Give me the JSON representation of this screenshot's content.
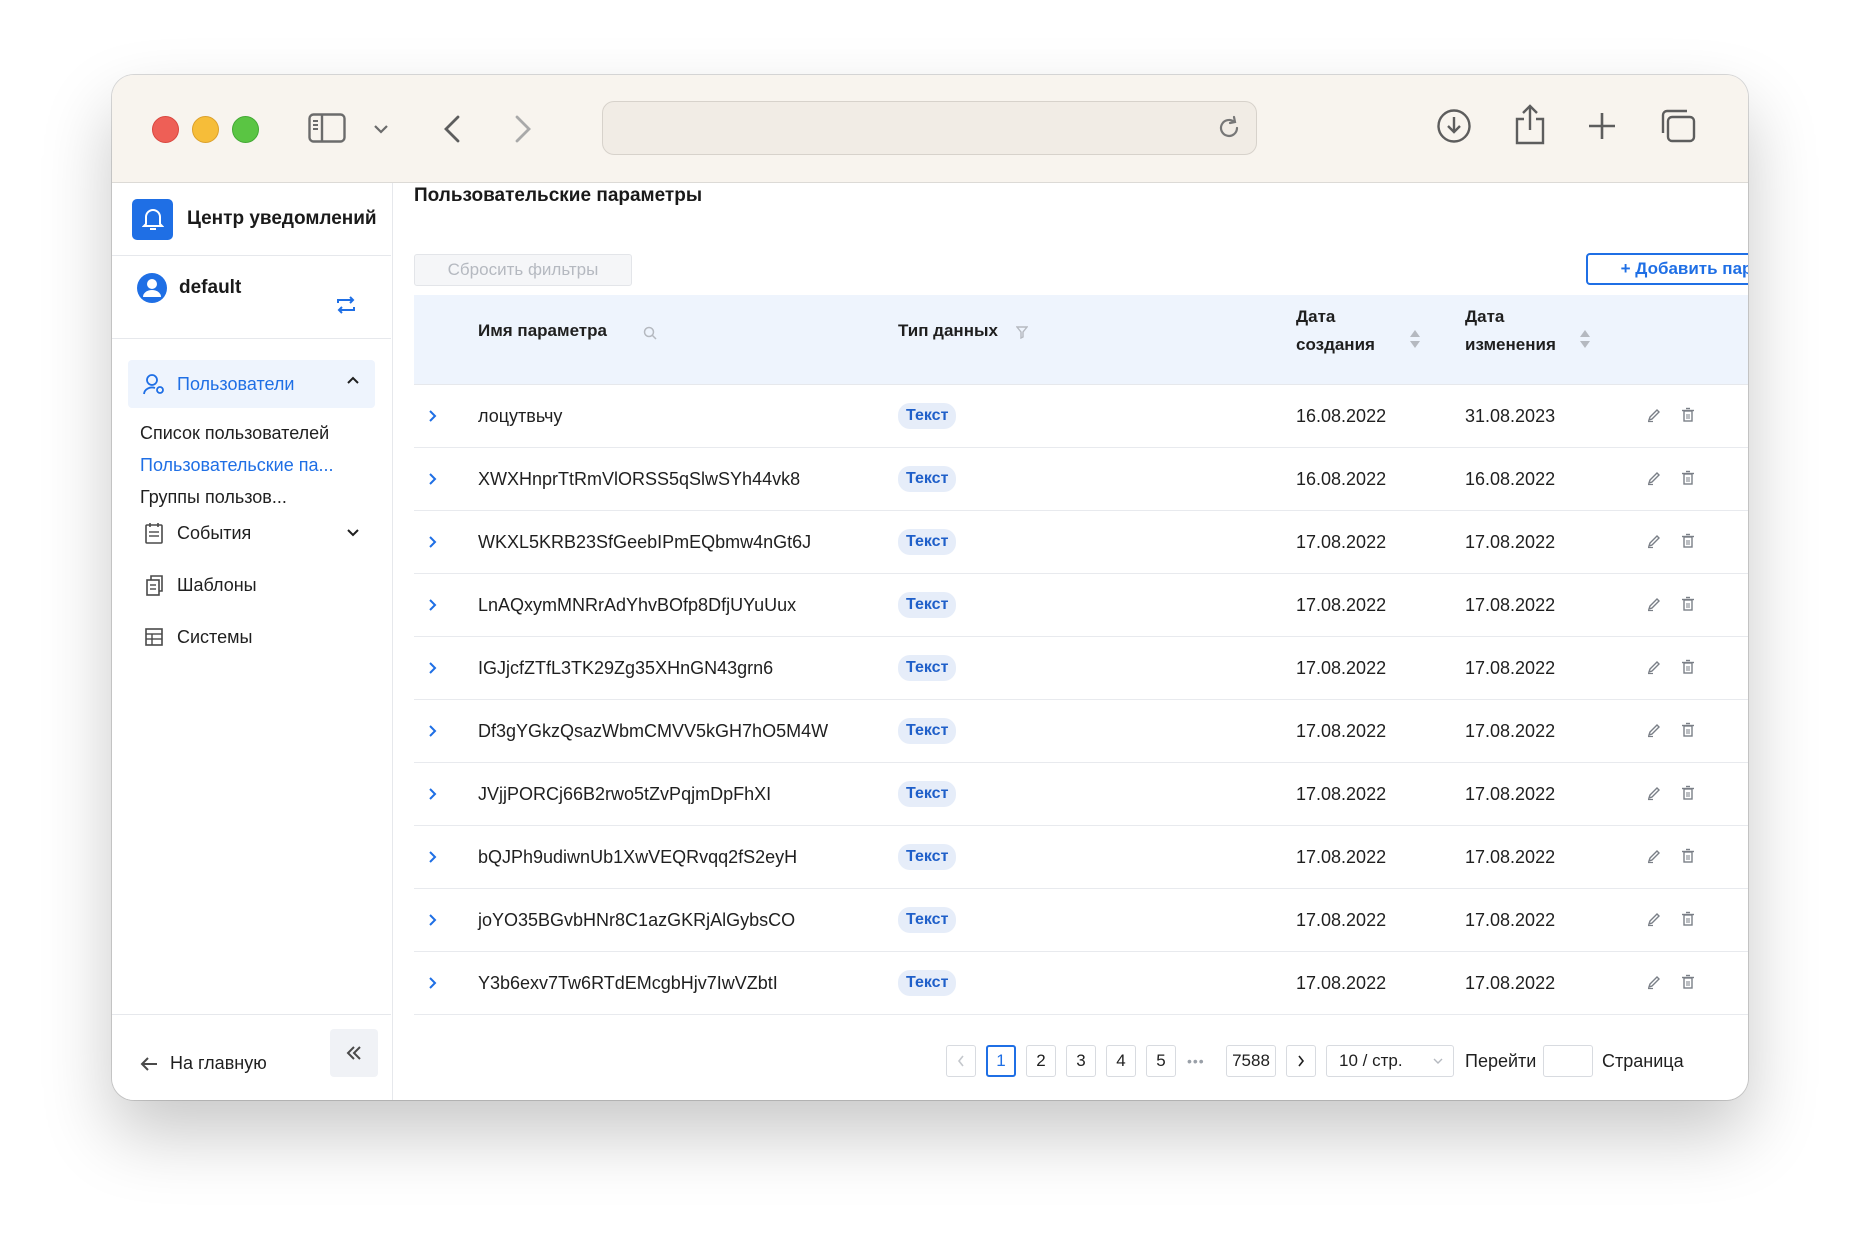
{
  "colors": {
    "accent": "#1f6fe5",
    "header_bg": "#eef4fd",
    "tag_bg": "#e6edf9",
    "titlebar_bg": "#f8f4ee"
  },
  "browser": {
    "url": "",
    "icons": [
      "sidebar-toggle-icon",
      "chevron-down-icon",
      "back-icon",
      "forward-icon",
      "reload-icon",
      "download-icon",
      "share-icon",
      "new-tab-icon",
      "tabs-overview-icon"
    ]
  },
  "sidebar": {
    "app_title": "Центр уведомлений",
    "user_name": "default",
    "group": {
      "label": "Пользователи",
      "icon": "user-settings-icon"
    },
    "subitems": [
      {
        "label": "Список пользователей",
        "active": false
      },
      {
        "label": "Пользовательские па...",
        "active": true
      },
      {
        "label": "Группы пользов...",
        "active": false
      }
    ],
    "items": [
      {
        "label": "События",
        "icon": "calendar-icon"
      },
      {
        "label": "Шаблоны",
        "icon": "copy-icon"
      },
      {
        "label": "Системы",
        "icon": "table-icon"
      }
    ],
    "home_label": "На главную"
  },
  "main": {
    "title": "Пользовательские параметры",
    "reset_button": "Сбросить фильтры",
    "add_button": "+ Добавить параметр",
    "columns": {
      "name": "Имя параметра",
      "type": "Тип данных",
      "created_l1": "Дата",
      "created_l2": "создания",
      "modified_l1": "Дата",
      "modified_l2": "изменения"
    },
    "rows": [
      {
        "name": "лоцутвьчу",
        "type": "Текст",
        "created": "16.08.2022",
        "modified": "31.08.2023"
      },
      {
        "name": "XWXHnprTtRmVlORSS5qSlwSYh44vk8",
        "type": "Текст",
        "created": "16.08.2022",
        "modified": "16.08.2022"
      },
      {
        "name": "WKXL5KRB23SfGeebIPmEQbmw4nGt6J",
        "type": "Текст",
        "created": "17.08.2022",
        "modified": "17.08.2022"
      },
      {
        "name": "LnAQxymMNRrAdYhvBOfp8DfjUYuUux",
        "type": "Текст",
        "created": "17.08.2022",
        "modified": "17.08.2022"
      },
      {
        "name": "IGJjcfZTfL3TK29Zg35XHnGN43grn6",
        "type": "Текст",
        "created": "17.08.2022",
        "modified": "17.08.2022"
      },
      {
        "name": "Df3gYGkzQsazWbmCMVV5kGH7hO5M4W",
        "type": "Текст",
        "created": "17.08.2022",
        "modified": "17.08.2022"
      },
      {
        "name": "JVjjPORCj66B2rwo5tZvPqjmDpFhXI",
        "type": "Текст",
        "created": "17.08.2022",
        "modified": "17.08.2022"
      },
      {
        "name": "bQJPh9udiwnUb1XwVEQRvqq2fS2eyH",
        "type": "Текст",
        "created": "17.08.2022",
        "modified": "17.08.2022"
      },
      {
        "name": "joYO35BGvbHNr8C1azGKRjAlGybsCO",
        "type": "Текст",
        "created": "17.08.2022",
        "modified": "17.08.2022"
      },
      {
        "name": "Y3b6exv7Tw6RTdEMcgbHjv7IwVZbtI",
        "type": "Текст",
        "created": "17.08.2022",
        "modified": "17.08.2022"
      }
    ],
    "pagination": {
      "pages": [
        "1",
        "2",
        "3",
        "4",
        "5"
      ],
      "current": "1",
      "ellipsis": "•••",
      "last": "7588",
      "page_size": "10 / стр.",
      "goto_label": "Перейти",
      "goto_value": "",
      "page_label": "Страница"
    }
  }
}
